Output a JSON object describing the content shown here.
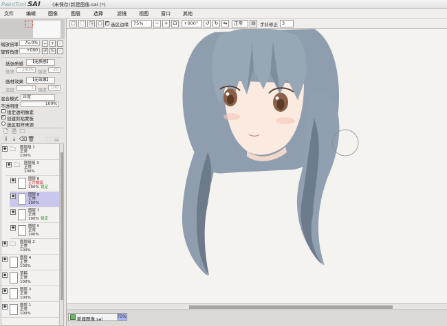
{
  "app": {
    "logo_small": "PaintTool",
    "logo_big": "SAI",
    "document_title": "(未保存)新建图像.sai (*)"
  },
  "menu": [
    "文件",
    "编辑",
    "图像",
    "图层",
    "选择",
    "滤镜",
    "视图",
    "窗口",
    "其他"
  ],
  "navigator": {
    "zoom_label": "缩放倍率",
    "zoom_value": "75.0%",
    "rotate_label": "旋转角度",
    "rotate_value": "+000"
  },
  "texture": {
    "paper_label": "纸张质感",
    "paper_value": "【无质感】",
    "paper_scale_label": "倍率",
    "paper_scale_value": "100%",
    "paper_strength_label": "强度",
    "paper_strength_value": "20",
    "effect_label": "画材效果",
    "effect_value": "【无效果】",
    "effect_width_label": "宽度",
    "effect_width_value": "1",
    "effect_strength_label": "强度",
    "effect_strength_value": "100"
  },
  "blend": {
    "mode_label": "混合模式",
    "mode_value": "正常",
    "opacity_label": "不透明度",
    "opacity_value": "100%"
  },
  "options": {
    "lock_alpha": "锁定透明像素",
    "clipping": "创建剪贴蒙板",
    "selection_source": "选区取样来源"
  },
  "layers": [
    {
      "kind": "folder",
      "indent": 0,
      "name": "图层组 1",
      "mode": "正常",
      "opacity": "100%",
      "tag": ""
    },
    {
      "kind": "folder",
      "indent": 1,
      "name": "图层组 3",
      "mode": "正常",
      "opacity": "100%",
      "tag": ""
    },
    {
      "kind": "layer",
      "indent": 2,
      "name": "图层 6",
      "mode": "正片叠底",
      "opacity": "100%",
      "tag": "锁定"
    },
    {
      "kind": "layer",
      "indent": 2,
      "name": "图层 8",
      "mode": "正常",
      "opacity": "100%",
      "tag": "",
      "selected": true
    },
    {
      "kind": "layer",
      "indent": 2,
      "name": "图层 7",
      "mode": "正常",
      "opacity": "100%",
      "tag": "锁定"
    },
    {
      "kind": "layer",
      "indent": 2,
      "name": "图层 5",
      "mode": "正常",
      "opacity": "100%",
      "tag": ""
    },
    {
      "kind": "folder",
      "indent": 0,
      "name": "图层组 2",
      "mode": "正常",
      "opacity": "100%",
      "tag": ""
    },
    {
      "kind": "layer",
      "indent": 0,
      "name": "图层 4",
      "mode": "正常",
      "opacity": "100%",
      "tag": ""
    },
    {
      "kind": "layer",
      "indent": 0,
      "name": "草稿",
      "mode": "正常",
      "opacity": "100%",
      "tag": ""
    },
    {
      "kind": "layer",
      "indent": 0,
      "name": "图层 3",
      "mode": "正常",
      "opacity": "100%",
      "tag": ""
    },
    {
      "kind": "layer",
      "indent": 0,
      "name": "图层 1",
      "mode": "正常",
      "opacity": "100%",
      "tag": ""
    }
  ],
  "toolbar": {
    "selection_edge": "选区边缘",
    "zoom": "75%",
    "rotation": "+000°",
    "mode": "正常",
    "stabilizer_label": "手抖修正",
    "stabilizer_value": "3"
  },
  "file_tab": {
    "name": "新建图像.sai",
    "zoom": "75%"
  },
  "colors": {
    "hair": "#8e9eae",
    "hair_dark": "#5f6e7e",
    "skin": "#fbeadf",
    "eye": "#8a6048",
    "selected_layer": "#c9c7ee"
  }
}
